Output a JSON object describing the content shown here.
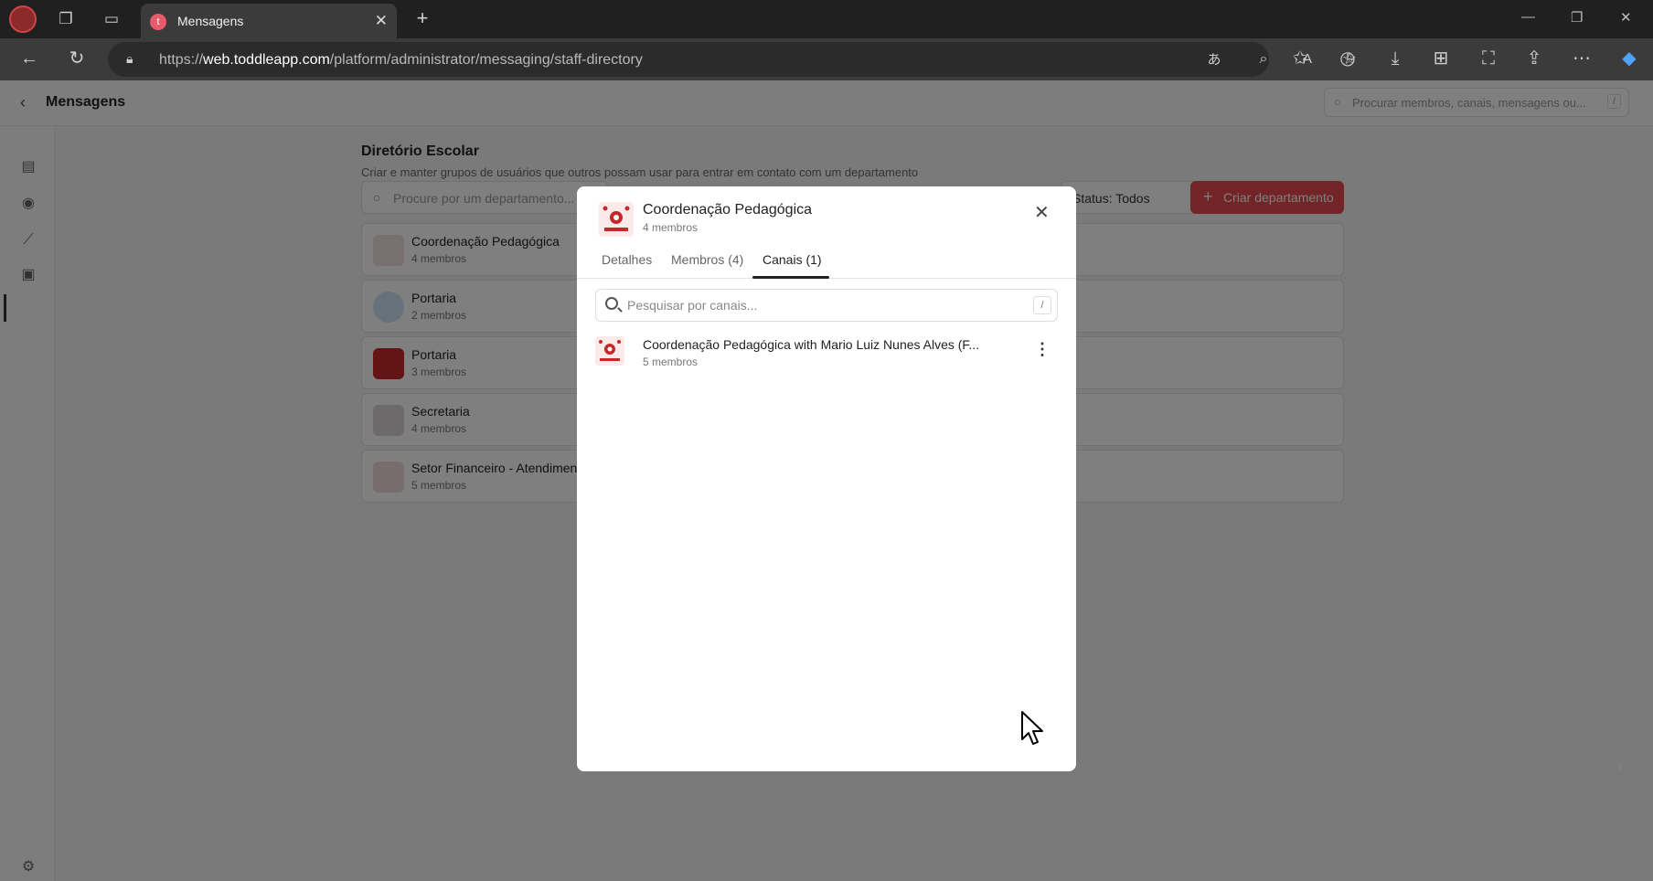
{
  "browser": {
    "tab_title": "Mensagens",
    "tab_favicon_letter": "t",
    "url_prefix": "https://",
    "url_host": "web.toddleapp.com",
    "url_path": "/platform/administrator/messaging/staff-directory"
  },
  "app": {
    "header_title": "Mensagens",
    "global_search_placeholder": "Procurar membros, canais, mensagens ou...",
    "global_search_shortcut": "/"
  },
  "directory": {
    "title": "Diretório Escolar",
    "subtitle": "Criar e manter grupos de usuários que outros possam usar para entrar em contato com um departamento",
    "search_placeholder": "Procure por um departamento...",
    "status_filter": "Status: Todos",
    "create_button": "Criar departamento",
    "departments": [
      {
        "name": "Coordenação Pedagógica",
        "count": "4 membros"
      },
      {
        "name": "Portaria",
        "count": "2 membros"
      },
      {
        "name": "Portaria",
        "count": "3 membros"
      },
      {
        "name": "Secretaria",
        "count": "4 membros"
      },
      {
        "name": "Setor Financeiro - Atendiment",
        "count": "5 membros"
      }
    ]
  },
  "modal": {
    "title": "Coordenação Pedagógica",
    "subtitle": "4 membros",
    "tabs": [
      "Detalhes",
      "Membros (4)",
      "Canais (1)"
    ],
    "active_tab": "Canais (1)",
    "search_placeholder": "Pesquisar por canais...",
    "search_shortcut": "/",
    "channels": [
      {
        "name": "Coordenação Pedagógica with Mario Luiz Nunes Alves (F...",
        "count": "5 membros"
      }
    ]
  },
  "colors": {
    "accent": "#e5484d",
    "overlay": "rgba(0,0,0,0.5)"
  }
}
